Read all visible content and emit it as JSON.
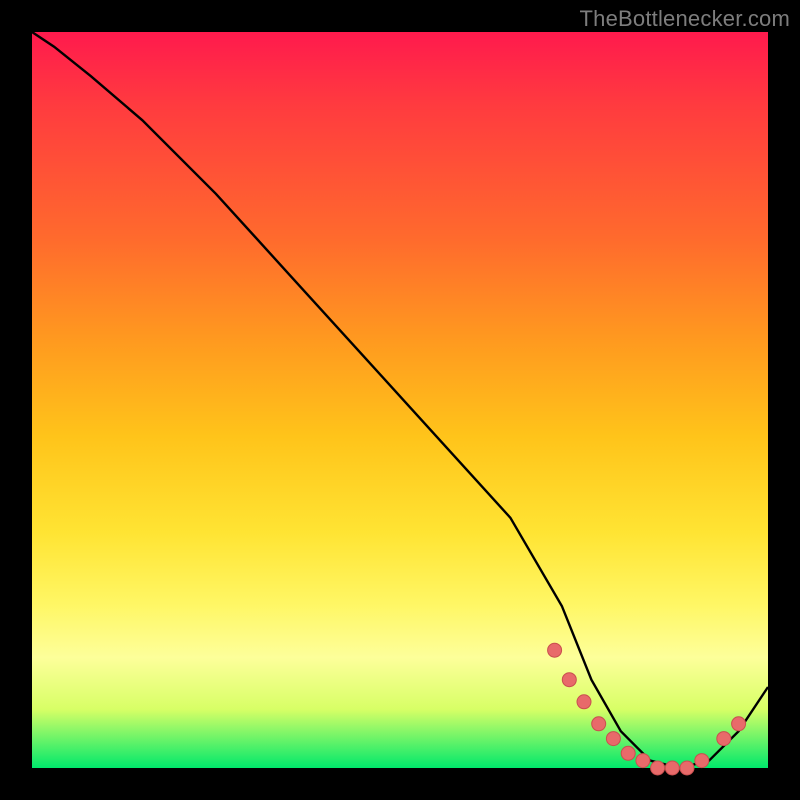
{
  "attribution": "TheBottlenecker.com",
  "chart_data": {
    "type": "line",
    "title": "",
    "xlabel": "",
    "ylabel": "",
    "xlim": [
      0,
      100
    ],
    "ylim": [
      0,
      100
    ],
    "x": [
      0,
      3,
      8,
      15,
      25,
      35,
      45,
      55,
      65,
      72,
      76,
      80,
      84,
      88,
      92,
      96,
      100
    ],
    "values": [
      100,
      98,
      94,
      88,
      78,
      67,
      56,
      45,
      34,
      22,
      12,
      5,
      1,
      0,
      1,
      5,
      11
    ],
    "markers": {
      "x": [
        71,
        73,
        75,
        77,
        79,
        81,
        83,
        85,
        87,
        89,
        91,
        94,
        96
      ],
      "values": [
        16,
        12,
        9,
        6,
        4,
        2,
        1,
        0,
        0,
        0,
        1,
        4,
        6
      ]
    },
    "colors": {
      "curve": "#000000",
      "marker_fill": "#e86a6a",
      "marker_stroke": "#c94f4f",
      "gradient_top": "#ff1a4d",
      "gradient_bottom": "#00e86b"
    }
  }
}
